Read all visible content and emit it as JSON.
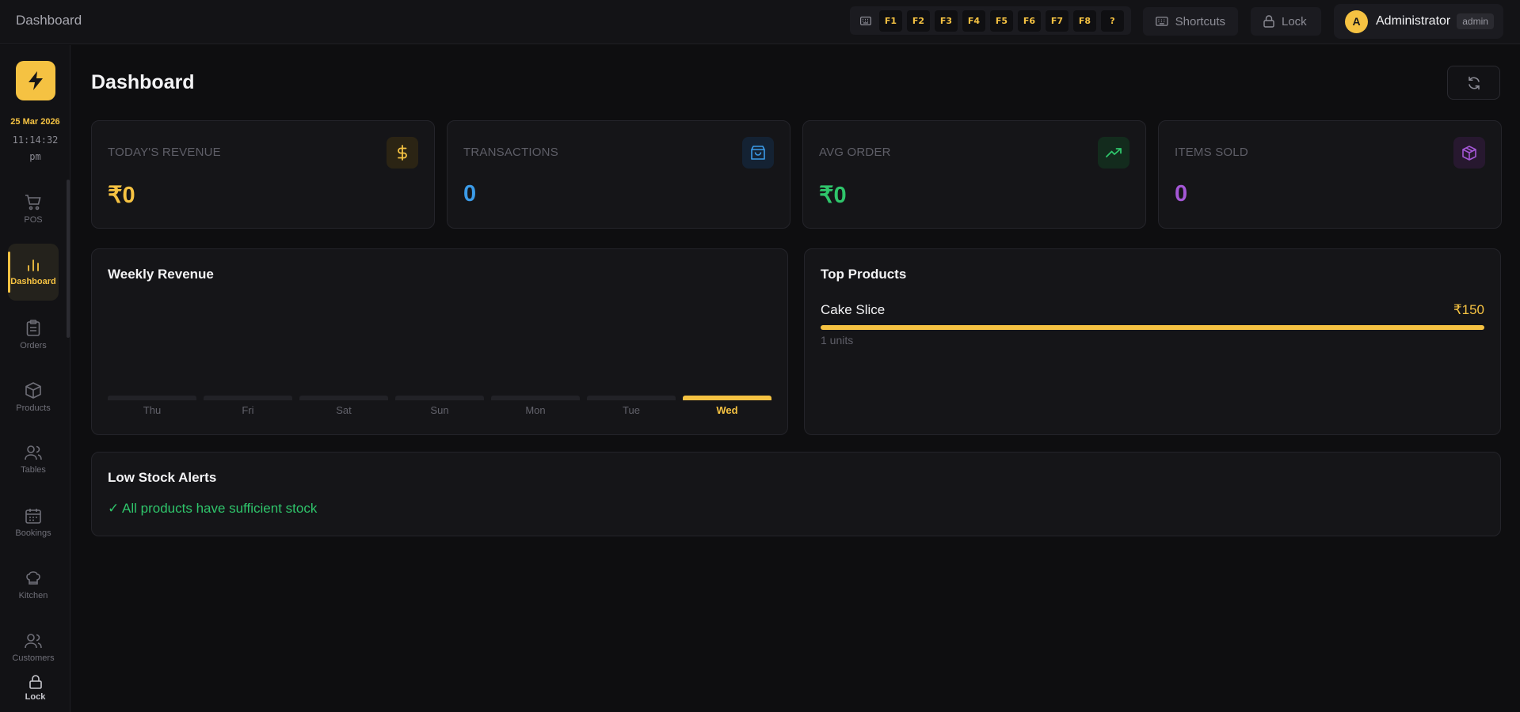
{
  "topbar": {
    "title": "Dashboard",
    "keyboard_icon": "keyboard-icon",
    "fkeys": [
      "F1",
      "F2",
      "F3",
      "F4",
      "F5",
      "F6",
      "F7",
      "F8",
      "?"
    ],
    "shortcuts_label": "Shortcuts",
    "lock_label": "Lock",
    "user": {
      "initial": "A",
      "name": "Administrator",
      "role": "admin"
    }
  },
  "sidebar": {
    "date": "25 Mar 2026",
    "time": "11:14:32",
    "ampm": "pm",
    "items": [
      {
        "label": "POS",
        "icon": "cart-icon"
      },
      {
        "label": "Dashboard",
        "icon": "bar-chart-icon",
        "active": true
      },
      {
        "label": "Orders",
        "icon": "clipboard-icon"
      },
      {
        "label": "Products",
        "icon": "box-icon"
      },
      {
        "label": "Tables",
        "icon": "users-icon"
      },
      {
        "label": "Bookings",
        "icon": "calendar-icon"
      },
      {
        "label": "Kitchen",
        "icon": "chef-hat-icon"
      },
      {
        "label": "Customers",
        "icon": "customers-icon"
      }
    ],
    "lock_label": "Lock"
  },
  "main": {
    "title": "Dashboard",
    "stats": [
      {
        "label": "TODAY'S REVENUE",
        "value": "₹0",
        "color": "#f5c242",
        "icon": "dollar-icon"
      },
      {
        "label": "TRANSACTIONS",
        "value": "0",
        "color": "#3b9be8",
        "icon": "shopping-bag-icon"
      },
      {
        "label": "AVG ORDER",
        "value": "₹0",
        "color": "#2fc56b",
        "icon": "trending-up-icon"
      },
      {
        "label": "ITEMS SOLD",
        "value": "0",
        "color": "#a457d6",
        "icon": "package-icon"
      }
    ],
    "weekly_revenue": {
      "title": "Weekly Revenue",
      "days": [
        "Thu",
        "Fri",
        "Sat",
        "Sun",
        "Mon",
        "Tue",
        "Wed"
      ],
      "active_day": "Wed"
    },
    "top_products": {
      "title": "Top Products",
      "items": [
        {
          "name": "Cake Slice",
          "price": "₹150",
          "units": "1 units",
          "share": 1.0
        }
      ]
    },
    "low_stock": {
      "title": "Low Stock Alerts",
      "message": "✓ All products have sufficient stock"
    }
  },
  "colors": {
    "accent": "#f5c242",
    "success": "#2fc56b",
    "info": "#3b9be8",
    "purple": "#a457d6"
  }
}
